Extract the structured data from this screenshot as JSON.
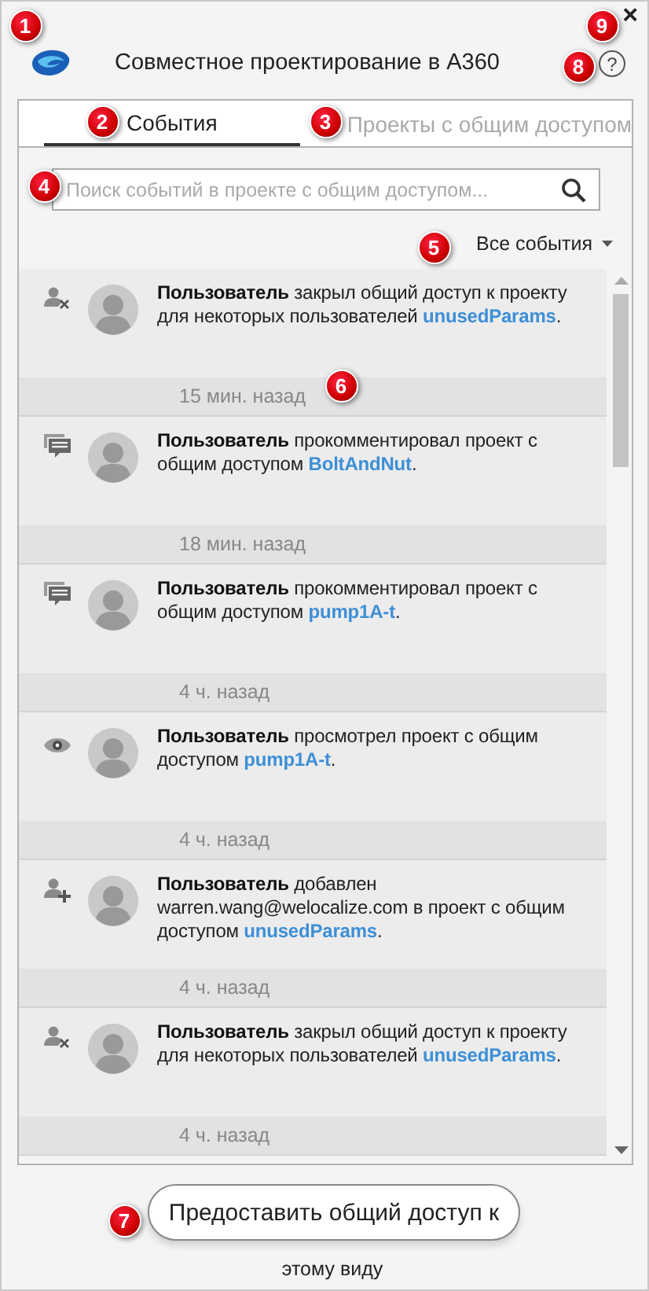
{
  "window": {
    "title": "Совместное проектирование в A360",
    "close": "×",
    "help": "?"
  },
  "tabs": [
    {
      "label": "События",
      "selected": true
    },
    {
      "label": "Проекты с общим доступом",
      "selected": false
    }
  ],
  "search": {
    "placeholder": "Поиск событий в проекте с общим доступом..."
  },
  "filter": {
    "label": "Все события"
  },
  "events": [
    {
      "kind": "unshare",
      "actor": "Пользователь",
      "action": "закрыл общий доступ к проекту для некоторых пользователей",
      "project": "unusedParams",
      "end": ".",
      "time": "15 мин. назад"
    },
    {
      "kind": "comment",
      "actor": "Пользователь",
      "action": "прокомментировал проект с общим доступом",
      "project": "BoltAndNut",
      "end": ".",
      "time": "18 мин. назад"
    },
    {
      "kind": "comment",
      "actor": "Пользователь",
      "action": "прокомментировал проект с общим доступом",
      "project": "pump1A-t",
      "end": ".",
      "time": "4 ч. назад"
    },
    {
      "kind": "view",
      "actor": "Пользователь",
      "action": "просмотрел проект с общим доступом",
      "project": "pump1A-t",
      "end": ".",
      "time": "4 ч. назад"
    },
    {
      "kind": "add",
      "actor": "Пользователь",
      "action": "добавлен warren.wang@welocalize.com в проект с общим доступом",
      "project": "unusedParams",
      "end": ".",
      "time": "4 ч. назад"
    },
    {
      "kind": "unshare",
      "actor": "Пользователь",
      "action": "закрыл общий доступ к проекту для некоторых пользователей",
      "project": "unusedParams",
      "end": ".",
      "time": "4 ч. назад"
    }
  ],
  "share_button": {
    "label": "Предоставить общий доступ к"
  },
  "share_button_overflow": "этому виду",
  "callouts": [
    {
      "label": "1"
    },
    {
      "label": "2"
    },
    {
      "label": "3"
    },
    {
      "label": "4"
    },
    {
      "label": "5"
    },
    {
      "label": "6"
    },
    {
      "label": "7"
    },
    {
      "label": "8"
    },
    {
      "label": "9"
    }
  ]
}
